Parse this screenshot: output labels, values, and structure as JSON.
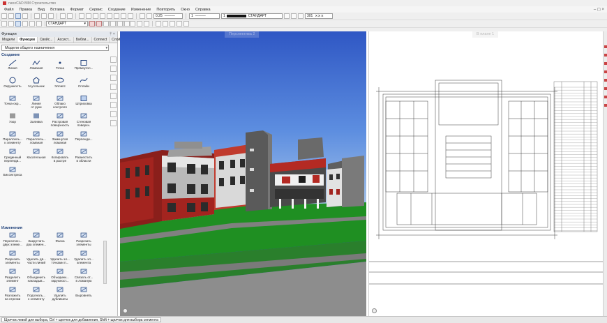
{
  "window": {
    "title": "nanoCAD BIM Строительство"
  },
  "menu": [
    "Файл",
    "Правка",
    "Вид",
    "Вставка",
    "Формат",
    "Сервис",
    "Создание",
    "Изменение",
    "Повторить",
    "Окно",
    "Справка"
  ],
  "toolbar": {
    "lineweight": "0.25",
    "linetype_scale": "1",
    "style_1": "СТАНДАРТ",
    "style_2": "СТАНДАРТ",
    "plot_value": "301"
  },
  "panel": {
    "title": "Функции",
    "tabs": [
      "Модели",
      "Функции",
      "Свойс...",
      "Ассист...",
      "Библи...",
      "Connect",
      "Слой"
    ],
    "active_tab": "Функции",
    "filter": "Модели общего назначения",
    "create_title": "Создание",
    "create_tools": [
      {
        "label": "Линия",
        "icon": "line-icon"
      },
      {
        "label": "Ломаная",
        "icon": "polyline-icon"
      },
      {
        "label": "Точка",
        "icon": "point-icon"
      },
      {
        "label": "Прямоугол...",
        "icon": "rectangle-icon"
      },
      {
        "label": "Окружность",
        "icon": "circle-icon"
      },
      {
        "label": "N-угольник",
        "icon": "polygon-icon"
      },
      {
        "label": "Эллипс",
        "icon": "ellipse-icon"
      },
      {
        "label": "Сплайн",
        "icon": "spline-icon"
      },
      {
        "label": "Точка-окр...",
        "icon": "point-circle-icon"
      },
      {
        "label": "Линия\nот руки",
        "icon": "freehand-icon"
      },
      {
        "label": "Облако\nконтроля",
        "icon": "cloud-icon"
      },
      {
        "label": "Штриховка",
        "icon": "hatch-icon"
      },
      {
        "label": "Узор",
        "icon": "pattern-icon"
      },
      {
        "label": "Заливка",
        "icon": "fill-icon"
      },
      {
        "label": "Растровая\nповерхность",
        "icon": "raster-surface-icon"
      },
      {
        "label": "Стеновая\nповерхн.",
        "icon": "wall-surface-icon"
      },
      {
        "label": "Параллель...\nк элементу",
        "icon": "parallel-icon"
      },
      {
        "label": "Параллель...\nломаная",
        "icon": "parallel-polyline-icon"
      },
      {
        "label": "Замкнутая\nломаная",
        "icon": "closed-polyline-icon"
      },
      {
        "label": "Перпенди...",
        "icon": "perpendicular-icon"
      },
      {
        "label": "Срединный\nперпенди...",
        "icon": "mid-perpendicular-icon"
      },
      {
        "label": "Касательная",
        "icon": "tangent-icon"
      },
      {
        "label": "Копировать\nв растре",
        "icon": "copy-raster-icon"
      },
      {
        "label": "Разместить\nв области",
        "icon": "place-area-icon"
      },
      {
        "label": "Биссектриса",
        "icon": "bisector-icon"
      }
    ],
    "edit_title": "Изменения",
    "edit_tools": [
      {
        "label": "Пересечен...\nдвух элеме...",
        "icon": "intersect-icon"
      },
      {
        "label": "Закруглить\nдва элемен...",
        "icon": "fillet-icon"
      },
      {
        "label": "Фаска",
        "icon": "chamfer-icon"
      },
      {
        "label": "Разрезать\nэлементы",
        "icon": "cut-icon"
      },
      {
        "label": "Разрезать\nэлементы",
        "icon": "cut-elements-icon"
      },
      {
        "label": "Удалить дв...\nчасти линий",
        "icon": "delete-parts-icon"
      },
      {
        "label": "Удалить эл...\nточками п...",
        "icon": "delete-points-icon"
      },
      {
        "label": "Удалить эл...\nэлемента",
        "icon": "delete-element-icon"
      },
      {
        "label": "Разделить\nэлемент",
        "icon": "split-icon"
      },
      {
        "label": "Объединить\nнакладыв...",
        "icon": "merge-icon"
      },
      {
        "label": "Объедини...\nокружност...",
        "icon": "merge-circle-icon"
      },
      {
        "label": "Связать от...\nв ломаную",
        "icon": "join-icon"
      },
      {
        "label": "Разложить\nна отрезки",
        "icon": "explode-icon"
      },
      {
        "label": "Подогнать...\nк элементу",
        "icon": "fit-icon"
      },
      {
        "label": "Удалить\nдубликаты",
        "icon": "dedupe-icon"
      },
      {
        "label": "Выровнять",
        "icon": "align-icon"
      }
    ]
  },
  "views": {
    "perspective_label": "Перспектива 2",
    "plan_label": "В плане 1"
  },
  "colors": {
    "sky_top": "#2f57c4",
    "grass": "#1f8f22",
    "accent_red": "#a3241f"
  },
  "status": {
    "hint": "Щелчок левой для выбора, Ctrl + щелчок для добавления, Shift + щелчок для выбора сегмента"
  }
}
